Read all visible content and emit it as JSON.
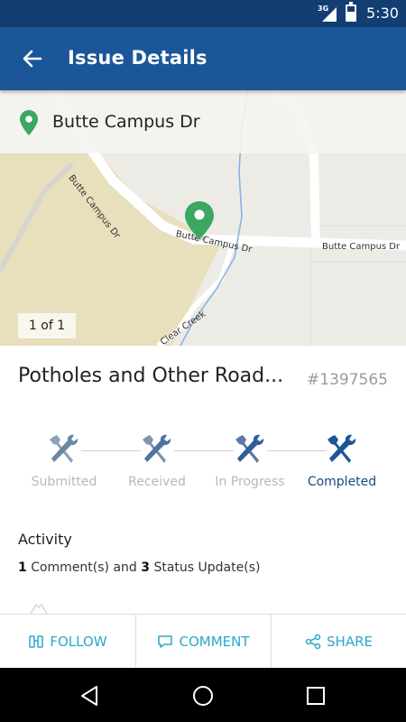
{
  "status_bar": {
    "network": "3G",
    "time": "5:30"
  },
  "app_bar": {
    "title": "Issue Details",
    "back_icon": "arrow-back-icon"
  },
  "map": {
    "address": "Butte Campus Dr",
    "pager": "1 of 1",
    "road_labels": [
      "Butte Campus Dr",
      "Butte Campus Dr",
      "Butte Campus Dr",
      "Clear Creek"
    ],
    "colors": {
      "land": "#ecebe6",
      "field": "#e8dfbd",
      "road": "#ffffff",
      "creek": "#8ab2e6",
      "pin": "#3aa85e"
    }
  },
  "issue": {
    "title": "Potholes and Other Road...",
    "id": "#1397565"
  },
  "progress": {
    "steps": [
      {
        "label": "Submitted",
        "active": false
      },
      {
        "label": "Received",
        "active": false
      },
      {
        "label": "In Progress",
        "active": false
      },
      {
        "label": "Completed",
        "active": true
      }
    ],
    "colors": {
      "done_icon": "#1a5698",
      "inactive_text": "#b8b8b8",
      "active_text": "#1a4a80"
    }
  },
  "activity": {
    "heading": "Activity",
    "comments_count": "1",
    "comments_text": "Comment(s) and",
    "updates_count": "3",
    "updates_text": "Status Update(s)"
  },
  "actions": [
    {
      "label": "FOLLOW",
      "icon": "binoculars-icon"
    },
    {
      "label": "COMMENT",
      "icon": "comment-icon"
    },
    {
      "label": "SHARE",
      "icon": "share-icon"
    }
  ],
  "accent_color": "#2aa8c9",
  "brand_color": "#1a5698"
}
